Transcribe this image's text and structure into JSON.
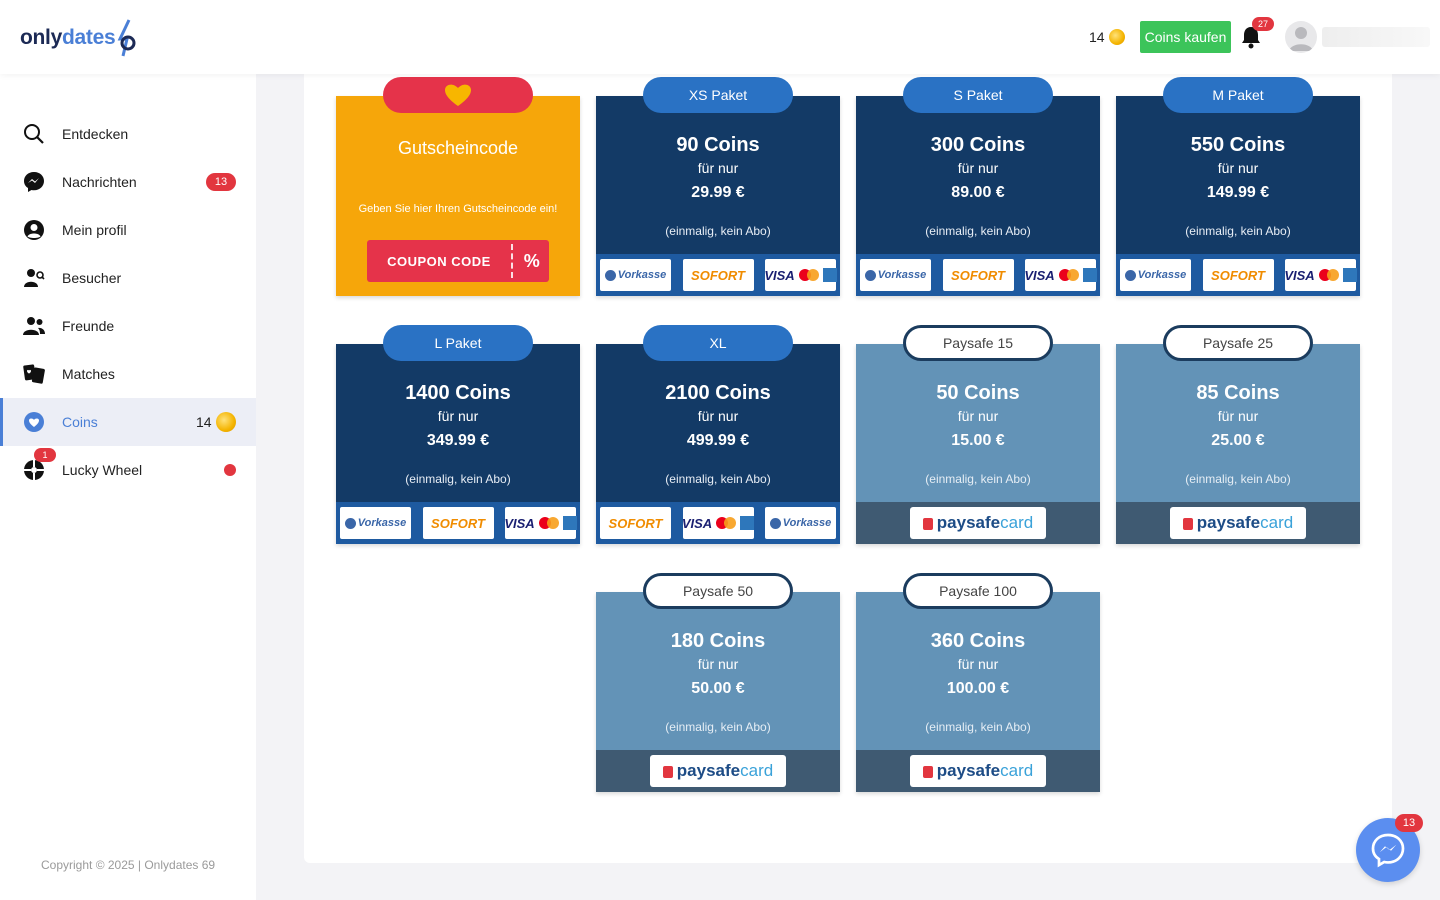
{
  "header": {
    "logo_part1": "only",
    "logo_part2": "dates",
    "coin_balance": "14",
    "buy_button": "Coins kaufen",
    "notification_count": "27"
  },
  "sidebar": {
    "items": [
      {
        "label": "Entdecken",
        "icon": "search-icon"
      },
      {
        "label": "Nachrichten",
        "icon": "messenger-icon",
        "badge": "13"
      },
      {
        "label": "Mein profil",
        "icon": "user-circle-icon"
      },
      {
        "label": "Besucher",
        "icon": "visitor-icon"
      },
      {
        "label": "Freunde",
        "icon": "friends-icon"
      },
      {
        "label": "Matches",
        "icon": "matches-icon"
      },
      {
        "label": "Coins",
        "icon": "heart-badge-icon",
        "count": "14",
        "active": true
      },
      {
        "label": "Lucky Wheel",
        "icon": "wheel-icon",
        "badge": "1"
      }
    ],
    "copyright": "Copyright © 2025 | Onlydates 69"
  },
  "coupon": {
    "title": "Gutscheincode",
    "text": "Geben Sie hier Ihren Gutscheincode ein!",
    "button": "COUPON CODE",
    "button_icon": "%"
  },
  "common": {
    "fur_nur": "für nur",
    "note": "(einmalig, kein Abo)",
    "vorkasse": "Vorkasse",
    "sofort": "SOFORT",
    "visa": "VISA",
    "paysafe1": "paysafe",
    "paysafe2": "card"
  },
  "packages": [
    {
      "name": "XS Paket",
      "coins": "90 Coins",
      "price": "29.99 €"
    },
    {
      "name": "S Paket",
      "coins": "300 Coins",
      "price": "89.00 €"
    },
    {
      "name": "M Paket",
      "coins": "550 Coins",
      "price": "149.99 €"
    },
    {
      "name": "L Paket",
      "coins": "1400 Coins",
      "price": "349.99 €"
    },
    {
      "name": "XL",
      "coins": "2100 Coins",
      "price": "499.99 €"
    },
    {
      "name": "Paysafe 15",
      "coins": "50 Coins",
      "price": "15.00 €"
    },
    {
      "name": "Paysafe 25",
      "coins": "85 Coins",
      "price": "25.00 €"
    },
    {
      "name": "Paysafe 50",
      "coins": "180 Coins",
      "price": "50.00 €"
    },
    {
      "name": "Paysafe 100",
      "coins": "360 Coins",
      "price": "100.00 €"
    }
  ],
  "messenger_badge": "13",
  "colors": {
    "card_dark": "#133a66",
    "card_light": "#6393b7",
    "coupon_orange": "#f6a60a",
    "accent_blue": "#4a7fd6",
    "buy_green": "#3cc45a",
    "badge_red": "#e2363f"
  }
}
